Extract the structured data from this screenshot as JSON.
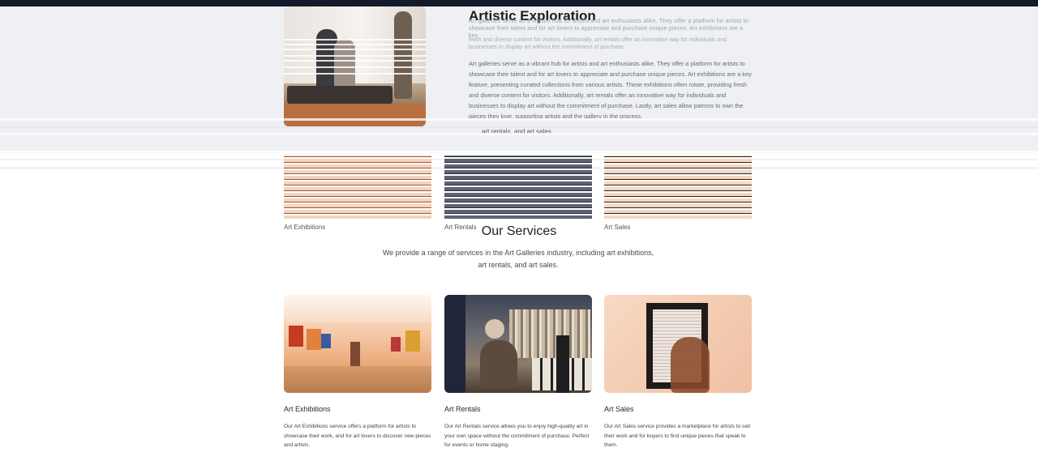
{
  "about": {
    "title": "Artistic Exploration",
    "ghost_text_1": "Art galleries serve as a vibrant hub for artists and art enthusiasts alike. They offer a platform for artists to showcase their talent and for art lovers to appreciate and purchase unique pieces. Art exhibitions are a key",
    "ghost_text_2": "fresh and diverse content for visitors. Additionally, art rentals offer an innovative way for individuals and businesses to display art without the commitment of purchase.",
    "body": "Art galleries serve as a vibrant hub for artists and art enthusiasts alike. They offer a platform for artists to showcase their talent and for art lovers to appreciate and purchase unique pieces. Art exhibitions are a key feature, presenting curated collections from various artists. These exhibitions often rotate, providing fresh and diverse content for visitors. Additionally, art rentals offer an innovative way for individuals and businesses to display art without the commitment of purchase. Lastly, art sales allow patrons to own the pieces they love, supporting artists and the gallery in the process.",
    "tail": "art rentals, and art sales."
  },
  "ghost_cards": {
    "labels": [
      "Art Exhibitions",
      "Art Rentals",
      "Art Sales"
    ]
  },
  "services": {
    "title": "Our Services",
    "intro": "We provide a range of services in the Art Galleries industry, including art exhibitions, art rentals, and art sales.",
    "cards": [
      {
        "title": "Art Exhibitions",
        "description": "Our Art Exhibitions service offers a platform for artists to showcase their work, and for art lovers to discover new pieces and artists."
      },
      {
        "title": "Art Rentals",
        "description": "Our Art Rentals service allows you to enjoy high-quality art in your own space without the commitment of purchase. Perfect for events or home staging."
      },
      {
        "title": "Art Sales",
        "description": "Our Art Sales service provides a marketplace for artists to sell their work and for buyers to find unique pieces that speak to them."
      }
    ]
  },
  "colors": {
    "top_bar": "#131a2c",
    "about_band": "#eef0f3"
  }
}
